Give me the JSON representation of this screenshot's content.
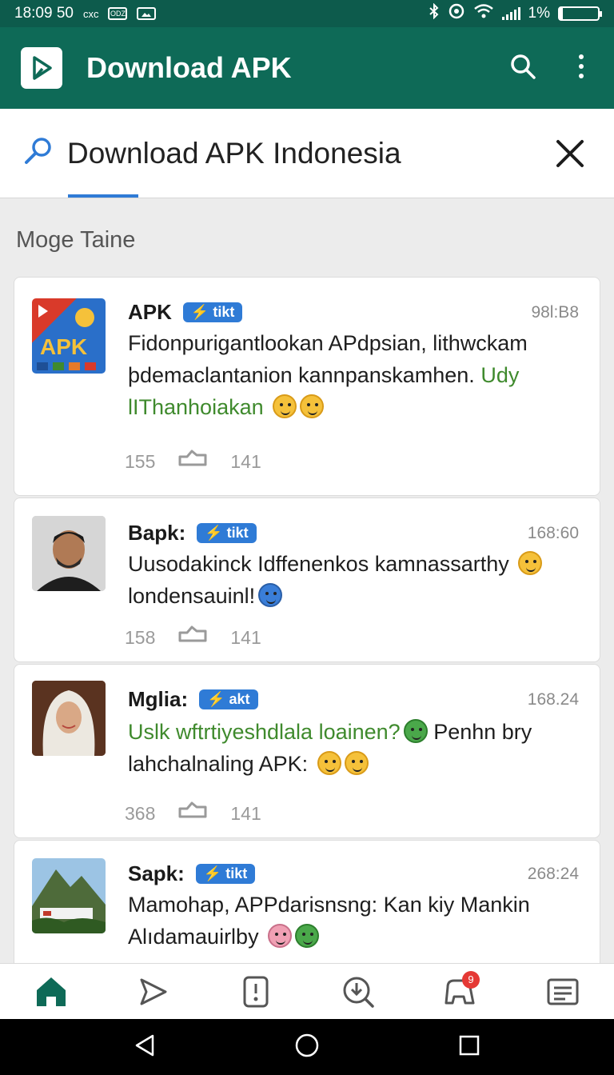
{
  "status_bar": {
    "time": "18:09 50",
    "carrier": "cxc",
    "mini_icon_1": "ODZ",
    "battery_text": "1%",
    "icons": [
      "bluetooth-icon",
      "dnd-icon",
      "wifi-icon",
      "signal-icon",
      "battery-icon"
    ]
  },
  "appbar": {
    "title": "Download APK",
    "icons": [
      "play-logo-icon",
      "search-icon",
      "more-vert-icon"
    ]
  },
  "search": {
    "query": "Download APK Indonesia",
    "icons": [
      "search-icon",
      "close-icon"
    ]
  },
  "section_title": "Moge Taine",
  "posts": [
    {
      "name": "APK",
      "badge": "tikt",
      "time": "98l:B8",
      "body_plain": "Fidonpurigantlookan APdpsian, lithwckam þdemaclantanion kannpanskamhen.",
      "body_green": "Udy lIThanhoiakan",
      "likes": "155",
      "shares": "141",
      "avatar_label": "APK"
    },
    {
      "name": "Bapk:",
      "badge": "tikt",
      "time": "168:60",
      "body_plain": "Uusodakinck Idffenenkos kamnassarthy",
      "body_plain_2": "londensauinl!",
      "likes": "158",
      "shares": "141"
    },
    {
      "name": "Mglia:",
      "badge": "akt",
      "time": "168.24",
      "body_green": "Uslk wftrtiyeshdlala loainen?",
      "body_plain": "Penhn",
      "body_plain_2": "bry lahchalnaling APK:",
      "likes": "368",
      "shares": "141"
    },
    {
      "name": "Sapk:",
      "badge": "tikt",
      "time": "268:24",
      "body_plain": "Mamohap, APPdarisnsng: Kan kiy Mankin",
      "body_plain_2": "Alıdamauirlby"
    }
  ],
  "bottom_nav": {
    "items": [
      "home-icon",
      "send-icon",
      "phone-icon",
      "download-icon",
      "games-icon",
      "notes-icon"
    ],
    "badge_count": "9"
  },
  "colors": {
    "primary": "#0e6a57",
    "status": "#0d5b4c",
    "accent": "#2f7bd6",
    "green_text": "#3f8a2d"
  }
}
